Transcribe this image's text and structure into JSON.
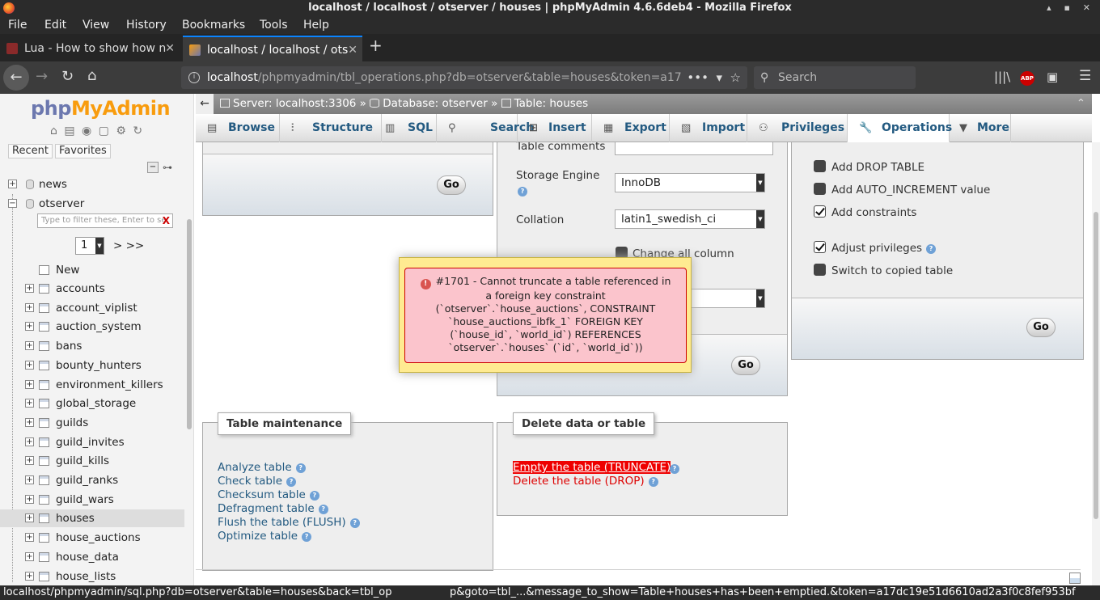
{
  "window": {
    "title": "localhost / localhost / otserver / houses | phpMyAdmin 4.6.6deb4 - Mozilla Firefox"
  },
  "menu": [
    "File",
    "Edit",
    "View",
    "History",
    "Bookmarks",
    "Tools",
    "Help"
  ],
  "tabs": [
    {
      "label": "Lua - How to show how n"
    },
    {
      "label": "localhost / localhost / ots"
    }
  ],
  "url": {
    "host": "localhost",
    "rest": "/phpmyadmin/tbl_operations.php?db=otserver&table=houses&token=a17..."
  },
  "search": {
    "placeholder": "Search"
  },
  "sidebar": {
    "logo_php": "php",
    "logo_myadmin": "MyAdmin",
    "recent": "Recent",
    "favorites": "Favorites",
    "filter_placeholder": "Type to filter these, Enter to se",
    "page": "1",
    "page_next": "> >>",
    "databases": [
      "news",
      "otserver"
    ],
    "new_label": "New",
    "tables": [
      "accounts",
      "account_viplist",
      "auction_system",
      "bans",
      "bounty_hunters",
      "environment_killers",
      "global_storage",
      "guilds",
      "guild_invites",
      "guild_kills",
      "guild_ranks",
      "guild_wars",
      "houses",
      "house_auctions",
      "house_data",
      "house_lists"
    ]
  },
  "breadcrumb": {
    "server": "Server: localhost:3306",
    "database": "Database: otserver",
    "table": "Table: houses"
  },
  "main_tabs": [
    "Browse",
    "Structure",
    "SQL",
    "Search",
    "Insert",
    "Export",
    "Import",
    "Privileges",
    "Operations",
    "More"
  ],
  "options": {
    "table_comments": "Table comments",
    "storage_engine": "Storage Engine",
    "storage_engine_value": "InnoDB",
    "collation": "Collation",
    "collation_value": "latin1_swedish_ci",
    "change_all": "Change all column"
  },
  "copy": {
    "add_drop": "Add DROP TABLE",
    "add_auto": "Add AUTO_INCREMENT value",
    "add_constraints": "Add constraints",
    "adjust_privileges": "Adjust privileges",
    "switch_copied": "Switch to copied table"
  },
  "go": "Go",
  "maintenance": {
    "legend": "Table maintenance",
    "items": [
      "Analyze table",
      "Check table",
      "Checksum table",
      "Defragment table",
      "Flush the table (FLUSH)",
      "Optimize table"
    ]
  },
  "delete": {
    "legend": "Delete data or table",
    "truncate": "Empty the table (TRUNCATE)",
    "drop": "Delete the table (DROP)"
  },
  "error": {
    "lines": [
      "#1701 - Cannot truncate a table referenced in",
      "a foreign key constraint",
      "(`otserver`.`house_auctions`, CONSTRAINT",
      "`house_auctions_ibfk_1` FOREIGN KEY",
      "(`house_id`, `world_id`) REFERENCES",
      "`otserver`.`houses` (`id`, `world_id`))"
    ]
  },
  "status": {
    "left": "localhost/phpmyadmin/sql.php?db=otserver&table=houses&back=tbl_op",
    "right": "p&goto=tbl_...&message_to_show=Table+houses+has+been+emptied.&token=a17dc19e51d6610ad2a3f0c8fef953bf"
  }
}
